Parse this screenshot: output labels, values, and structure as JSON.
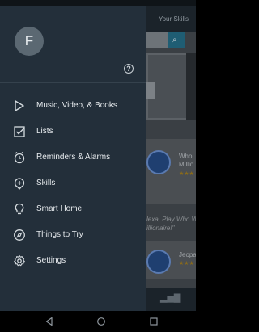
{
  "background_app": {
    "header_text": "Your Skills",
    "items": [
      {
        "title_line1": "Who",
        "title_line2": "Millio",
        "stars": "★★★"
      },
      {
        "title_line1": "Jeopa",
        "stars": "★★★"
      }
    ],
    "quote_line1": "lexa, Play Who W",
    "quote_line2": "illionaire!\""
  },
  "drawer": {
    "avatar_initial": "F",
    "menu": [
      {
        "label": "Music, Video, & Books",
        "icon": "play-icon"
      },
      {
        "label": "Lists",
        "icon": "checkbox-icon"
      },
      {
        "label": "Reminders & Alarms",
        "icon": "alarm-clock-icon"
      },
      {
        "label": "Skills",
        "icon": "skills-icon"
      },
      {
        "label": "Smart Home",
        "icon": "lightbulb-icon"
      },
      {
        "label": "Things to Try",
        "icon": "compass-icon"
      },
      {
        "label": "Settings",
        "icon": "gear-icon"
      }
    ]
  },
  "navbar": {
    "icons": [
      "back-icon",
      "home-icon",
      "recents-icon"
    ]
  },
  "colors": {
    "drawer_bg": "#232f3a",
    "avatar_bg": "#5b6872",
    "text": "#e8ecef",
    "accent_teal": "#1f5d73"
  }
}
